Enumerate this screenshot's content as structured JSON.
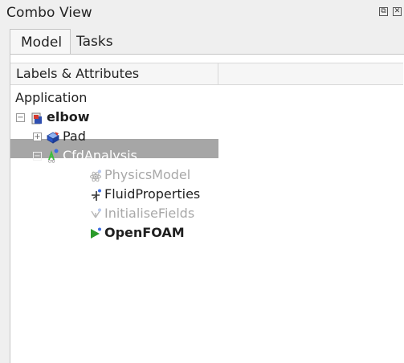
{
  "window": {
    "title": "Combo View",
    "float_icon": "float-icon",
    "close_icon": "close-icon"
  },
  "tabs": [
    {
      "label": "Model",
      "active": true
    },
    {
      "label": "Tasks",
      "active": false
    }
  ],
  "tree": {
    "column_header": "Labels & Attributes",
    "root_label": "Application",
    "items": [
      {
        "label": "elbow",
        "icon": "document-icon",
        "expanded": true,
        "bold": true
      },
      {
        "label": "Pad",
        "icon": "pad-icon",
        "expanded": false
      },
      {
        "label": "CfdAnalysis",
        "icon": "cfd-analysis-icon",
        "expanded": true,
        "selected": true
      },
      {
        "label": "PhysicsModel",
        "icon": "physics-model-icon",
        "grayed": true
      },
      {
        "label": "FluidProperties",
        "icon": "fluid-properties-icon"
      },
      {
        "label": "InitialiseFields",
        "icon": "initialise-fields-icon",
        "grayed": true
      },
      {
        "label": "OpenFOAM",
        "icon": "openfoam-solver-icon",
        "bold": true
      }
    ]
  },
  "colors": {
    "selection": "#a6a6a6",
    "grayed_text": "#a8a8a8",
    "background": "#efefef"
  }
}
